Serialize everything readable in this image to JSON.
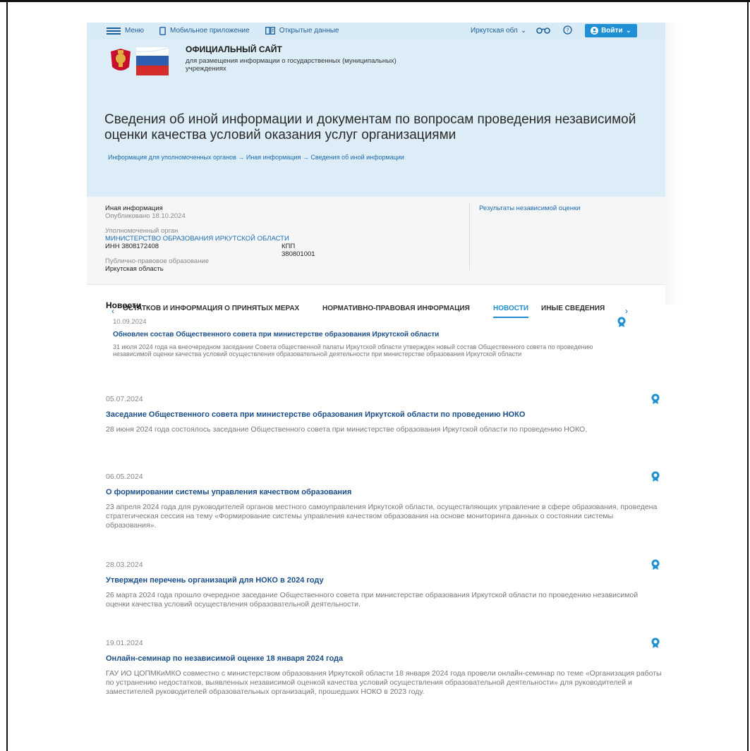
{
  "topbar": {
    "menu": "Меню",
    "mobile_app": "Мобильное приложение",
    "open_data": "Открытые данные",
    "region": "Иркутская обл",
    "login": "Войти"
  },
  "header": {
    "site_title": "ОФИЦИАЛЬНЫЙ САЙТ",
    "site_subtitle": "для размещения информации о государственных (муниципальных) учреждениях",
    "page_title": "Сведения об иной информации и документам по вопросам проведения независимой оценки качества условий оказания услуг организациями",
    "breadcrumb": "Информация для уполномоченных органов → Иная информация → Сведения об иной информации"
  },
  "info": {
    "type": "Иная информация",
    "published": "Опубликовано 18.10.2024",
    "authority_label": "Уполномоченный орган",
    "authority_name": "МИНИСТЕРСТВО ОБРАЗОВАНИЯ ИРКУТСКОЙ ОБЛАСТИ",
    "inn": "ИНН 3808172408",
    "kpp": "КПП 380801001",
    "entity_label": "Публично-правовое образование",
    "entity_value": "Иркутская область",
    "results_link": "Результаты независимой оценки"
  },
  "tabs": [
    {
      "label": "ОСТАТКОВ И ИНФОРМАЦИЯ О ПРИНЯТЫХ МЕРАХ"
    },
    {
      "label": "НОРМАТИВНО-ПРАВОВАЯ ИНФОРМАЦИЯ"
    },
    {
      "label": "НОВОСТИ"
    },
    {
      "label": "ИНЫЕ СВЕДЕНИЯ"
    }
  ],
  "section_title": "Новости",
  "news": [
    {
      "date": "10.09.2024",
      "title": "Обновлен состав Общественного совета при министерстве образования Иркутской области",
      "text": "31 июля 2024 года на внеочередном заседании Совета общественной палаты Иркутской области утвержден новый состав Общественного совета по проведению независимой оценки качества условий осуществления образовательной деятельности при министерстве образования Иркутской области"
    },
    {
      "date": "05.07.2024",
      "title": "Заседание Общественного совета при министерстве образования Иркутской области по проведению НОКО",
      "text": "28 июня 2024 года состоялось заседание Общественного совета при министерстве образования Иркутской области по проведению НОКО."
    },
    {
      "date": "06.05.2024",
      "title": "О формировании системы управления качеством образования",
      "text": "23 апреля 2024 года для руководителей органов местного самоуправления Иркутской области, осуществляющих управление в сфере образования, проведена стратегическая сессия на тему «Формирование системы управления качеством образования на основе мониторинга данных о состоянии системы образования»."
    },
    {
      "date": "28.03.2024",
      "title": "Утвержден перечень организаций для НОКО в 2024 году",
      "text": "26 марта 2024 года прошло очередное заседание Общественного совета при министерстве образования Иркутской области по проведению независимой оценки качества условий осуществления образовательной деятельности."
    },
    {
      "date": "19.01.2024",
      "title": "Онлайн-семинар по независимой оценке 18 января 2024 года",
      "text": "ГАУ ИО ЦОПМКиМКО совместно с министерством образования Иркутской области 18 января 2024 года провели онлайн-семинар по теме «Организация работы по устранению недостатков, выявленных независимой оценкой качества условий осуществления образовательной деятельности» для руководителей и заместителей руководителей образовательных организаций, прошедших НОКО в 2023 году."
    }
  ],
  "colors": {
    "accent": "#1e8fd0",
    "header_bg": "#dcedf8",
    "link": "#1e6bb0"
  }
}
